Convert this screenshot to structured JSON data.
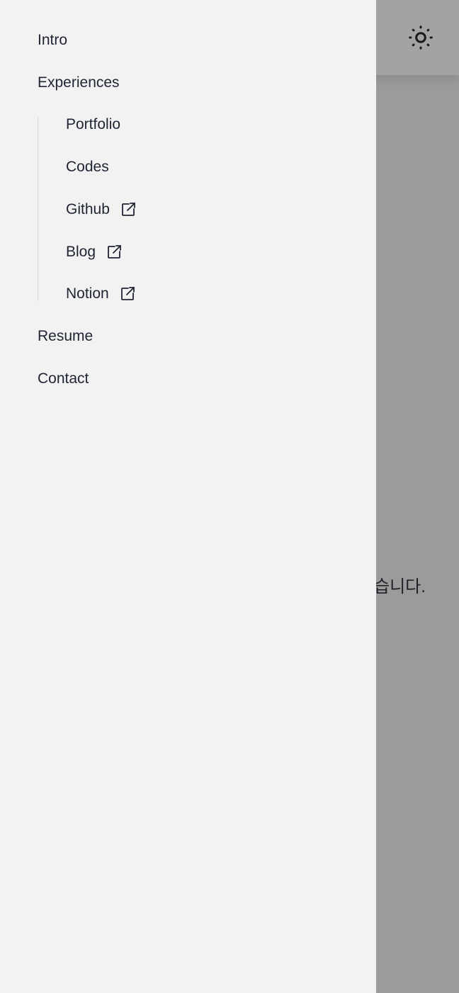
{
  "background": {
    "partial_text": "습니다."
  },
  "header": {
    "theme_toggle_icon": "sun-icon"
  },
  "drawer": {
    "items": [
      {
        "label": "Intro"
      },
      {
        "label": "Experiences"
      },
      {
        "label": "Resume"
      },
      {
        "label": "Contact"
      }
    ],
    "sub_items": [
      {
        "label": "Portfolio",
        "external": false
      },
      {
        "label": "Codes",
        "external": false
      },
      {
        "label": "Github",
        "external": true,
        "icon": "external-link-icon"
      },
      {
        "label": "Blog",
        "external": true,
        "icon": "external-link-icon"
      },
      {
        "label": "Notion",
        "external": true,
        "icon": "external-link-icon"
      }
    ]
  },
  "colors": {
    "drawer_bg": "#f2f2f2",
    "overlay_bg": "#9b9b9b",
    "text": "#1f2433"
  }
}
